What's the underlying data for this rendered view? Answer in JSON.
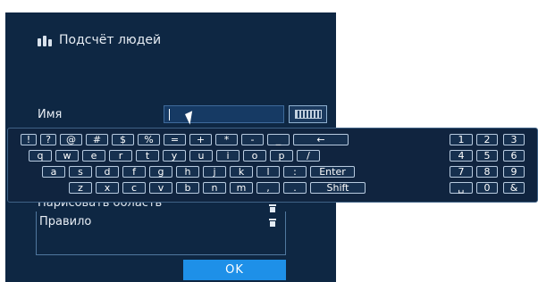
{
  "dialog": {
    "title": "Подсчёт людей",
    "name_label": "Имя",
    "name_value": "",
    "region_label": "Нарисовать область",
    "rule_label": "Правило",
    "ok_label": "OK"
  },
  "keyboard": {
    "row1": [
      "!",
      "?",
      "@",
      "#",
      "$",
      "%",
      "=",
      "+",
      "*",
      "-",
      "_",
      "←"
    ],
    "row2": [
      "q",
      "w",
      "e",
      "r",
      "t",
      "y",
      "u",
      "i",
      "o",
      "p",
      "/"
    ],
    "row3": [
      "a",
      "s",
      "d",
      "f",
      "g",
      "h",
      "j",
      "k",
      "l",
      ":",
      "Enter"
    ],
    "row4": [
      "z",
      "x",
      "c",
      "v",
      "b",
      "n",
      "m",
      ",",
      ".",
      "Shift"
    ],
    "numpad": [
      [
        "1",
        "2",
        "3"
      ],
      [
        "4",
        "5",
        "6"
      ],
      [
        "7",
        "8",
        "9"
      ],
      [
        "␣",
        "0",
        "&"
      ]
    ]
  }
}
